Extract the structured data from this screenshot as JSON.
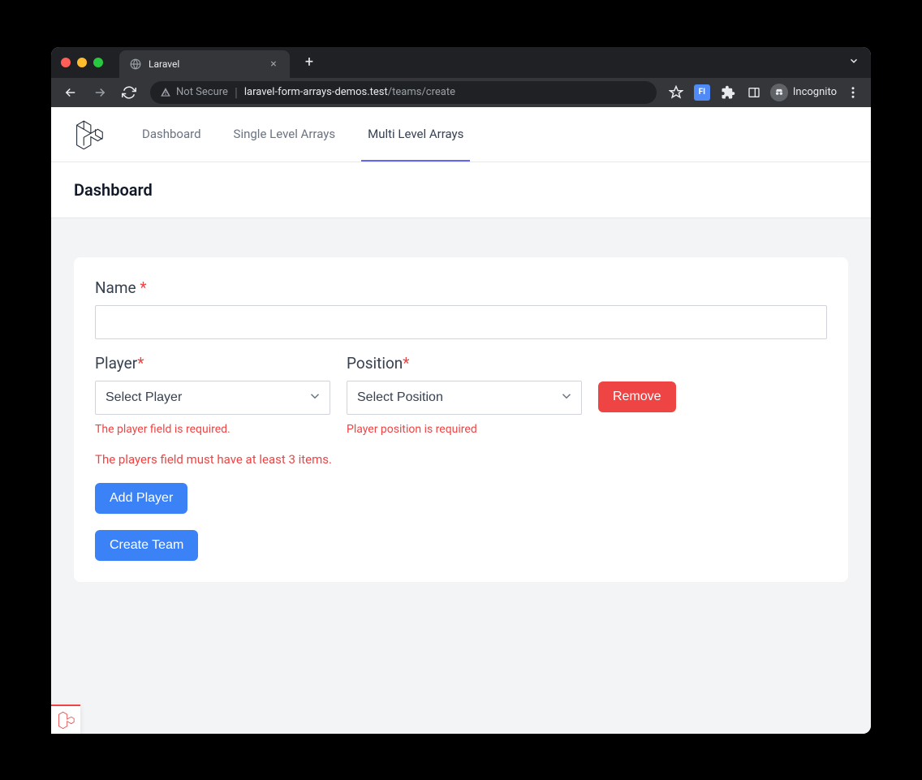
{
  "browser": {
    "tab_title": "Laravel",
    "not_secure_label": "Not Secure",
    "url_host": "laravel-form-arrays-demos.test",
    "url_path": "/teams/create",
    "incognito_label": "Incognito",
    "ext_badge": "FI"
  },
  "nav": {
    "items": [
      {
        "label": "Dashboard"
      },
      {
        "label": "Single Level Arrays"
      },
      {
        "label": "Multi Level Arrays"
      }
    ],
    "active_index": 2
  },
  "page": {
    "title": "Dashboard"
  },
  "form": {
    "name_label": "Name",
    "name_value": "",
    "player_label": "Player",
    "player_placeholder": "Select Player",
    "player_error": "The player field is required.",
    "position_label": "Position",
    "position_placeholder": "Select Position",
    "position_error": "Player position is required",
    "remove_label": "Remove",
    "global_error": "The players field must have at least 3 items.",
    "add_player_label": "Add Player",
    "submit_label": "Create Team"
  }
}
